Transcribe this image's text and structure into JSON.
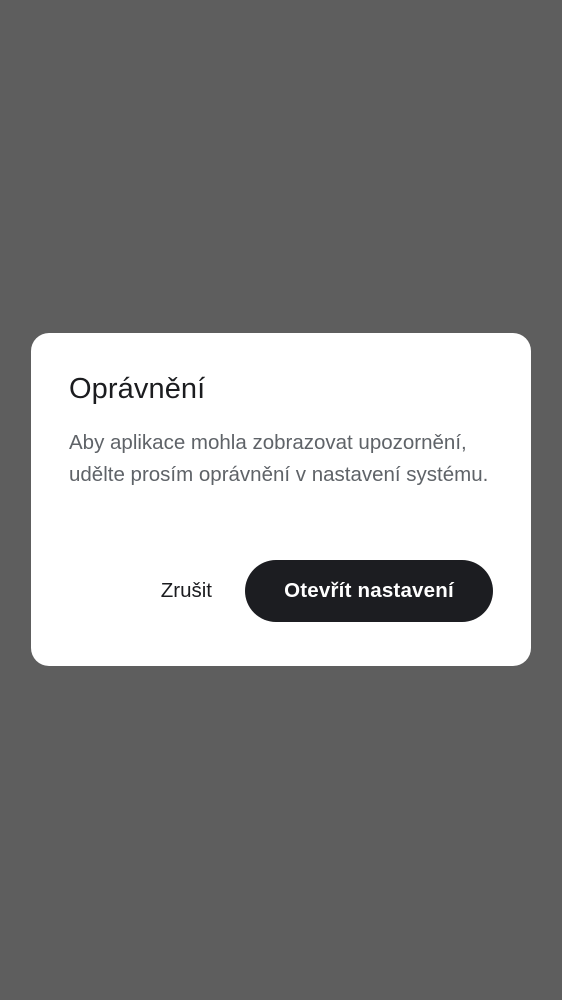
{
  "dialog": {
    "title": "Oprávnění",
    "message": "Aby aplikace mohla zobrazovat upozornění, udělte prosím oprávnění v nastavení systému.",
    "cancel_label": "Zrušit",
    "confirm_label": "Otevřít nastavení"
  },
  "colors": {
    "scrim": "#5e5e5e",
    "dialog_background": "#ffffff",
    "title_text": "#1b1c1f",
    "message_text": "#5f6368",
    "primary_button": "#1c1d21",
    "primary_button_text": "#ffffff"
  }
}
